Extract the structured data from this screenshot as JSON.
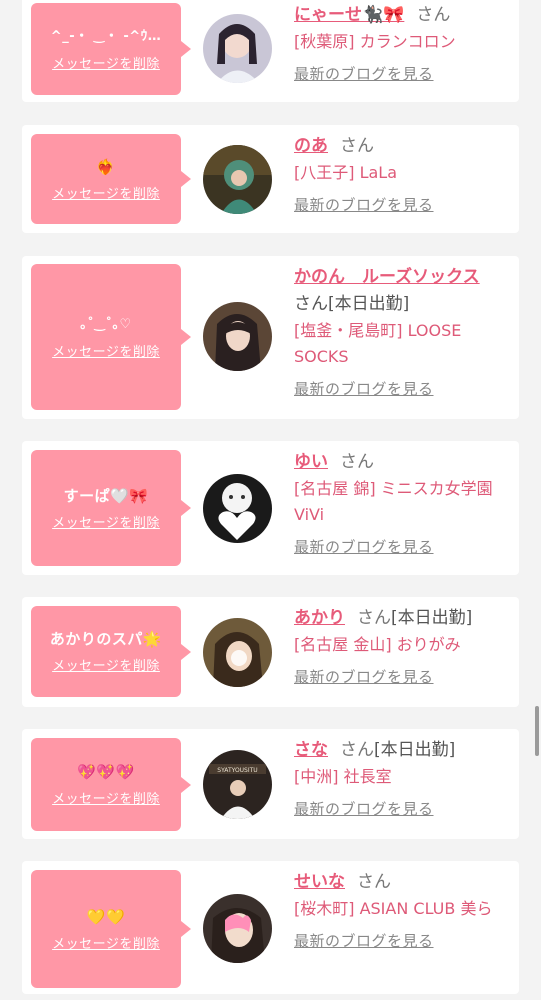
{
  "common": {
    "delete_label": "メッセージを削除",
    "blog_label": "最新のブログを見る",
    "san": "さん"
  },
  "cards": [
    {
      "message": "^_-・ ‿・ -^ｳ…",
      "name": "にゃーせ🐈‍⬛🎀",
      "status": "",
      "shop": "[秋葉原] カランコロン"
    },
    {
      "message": "❤️‍🔥",
      "name": "のあ",
      "status": "",
      "shop": "[八王子] LaLa"
    },
    {
      "message": "｡˚‿˚｡♡",
      "name": "かのん　ルーズソックス",
      "status": "[本日出勤]",
      "shop": "[塩釜・尾島町] LOOSE SOCKS"
    },
    {
      "message": "すーぱ🤍🎀",
      "name": "ゆい",
      "status": "",
      "shop": "[名古屋 錦] ミニスカ女学園ViVi"
    },
    {
      "message": "あかりのスパ🌟",
      "name": "あかり",
      "status": "[本日出勤]",
      "shop": "[名古屋 金山] おりがみ"
    },
    {
      "message": "💖💖💖",
      "name": "さな",
      "status": "[本日出勤]",
      "shop": "[中洲] 社長室"
    },
    {
      "message": "💛💛",
      "name": "せいな",
      "status": "",
      "shop": "[桜木町] ASIAN CLUB 美ら"
    }
  ]
}
